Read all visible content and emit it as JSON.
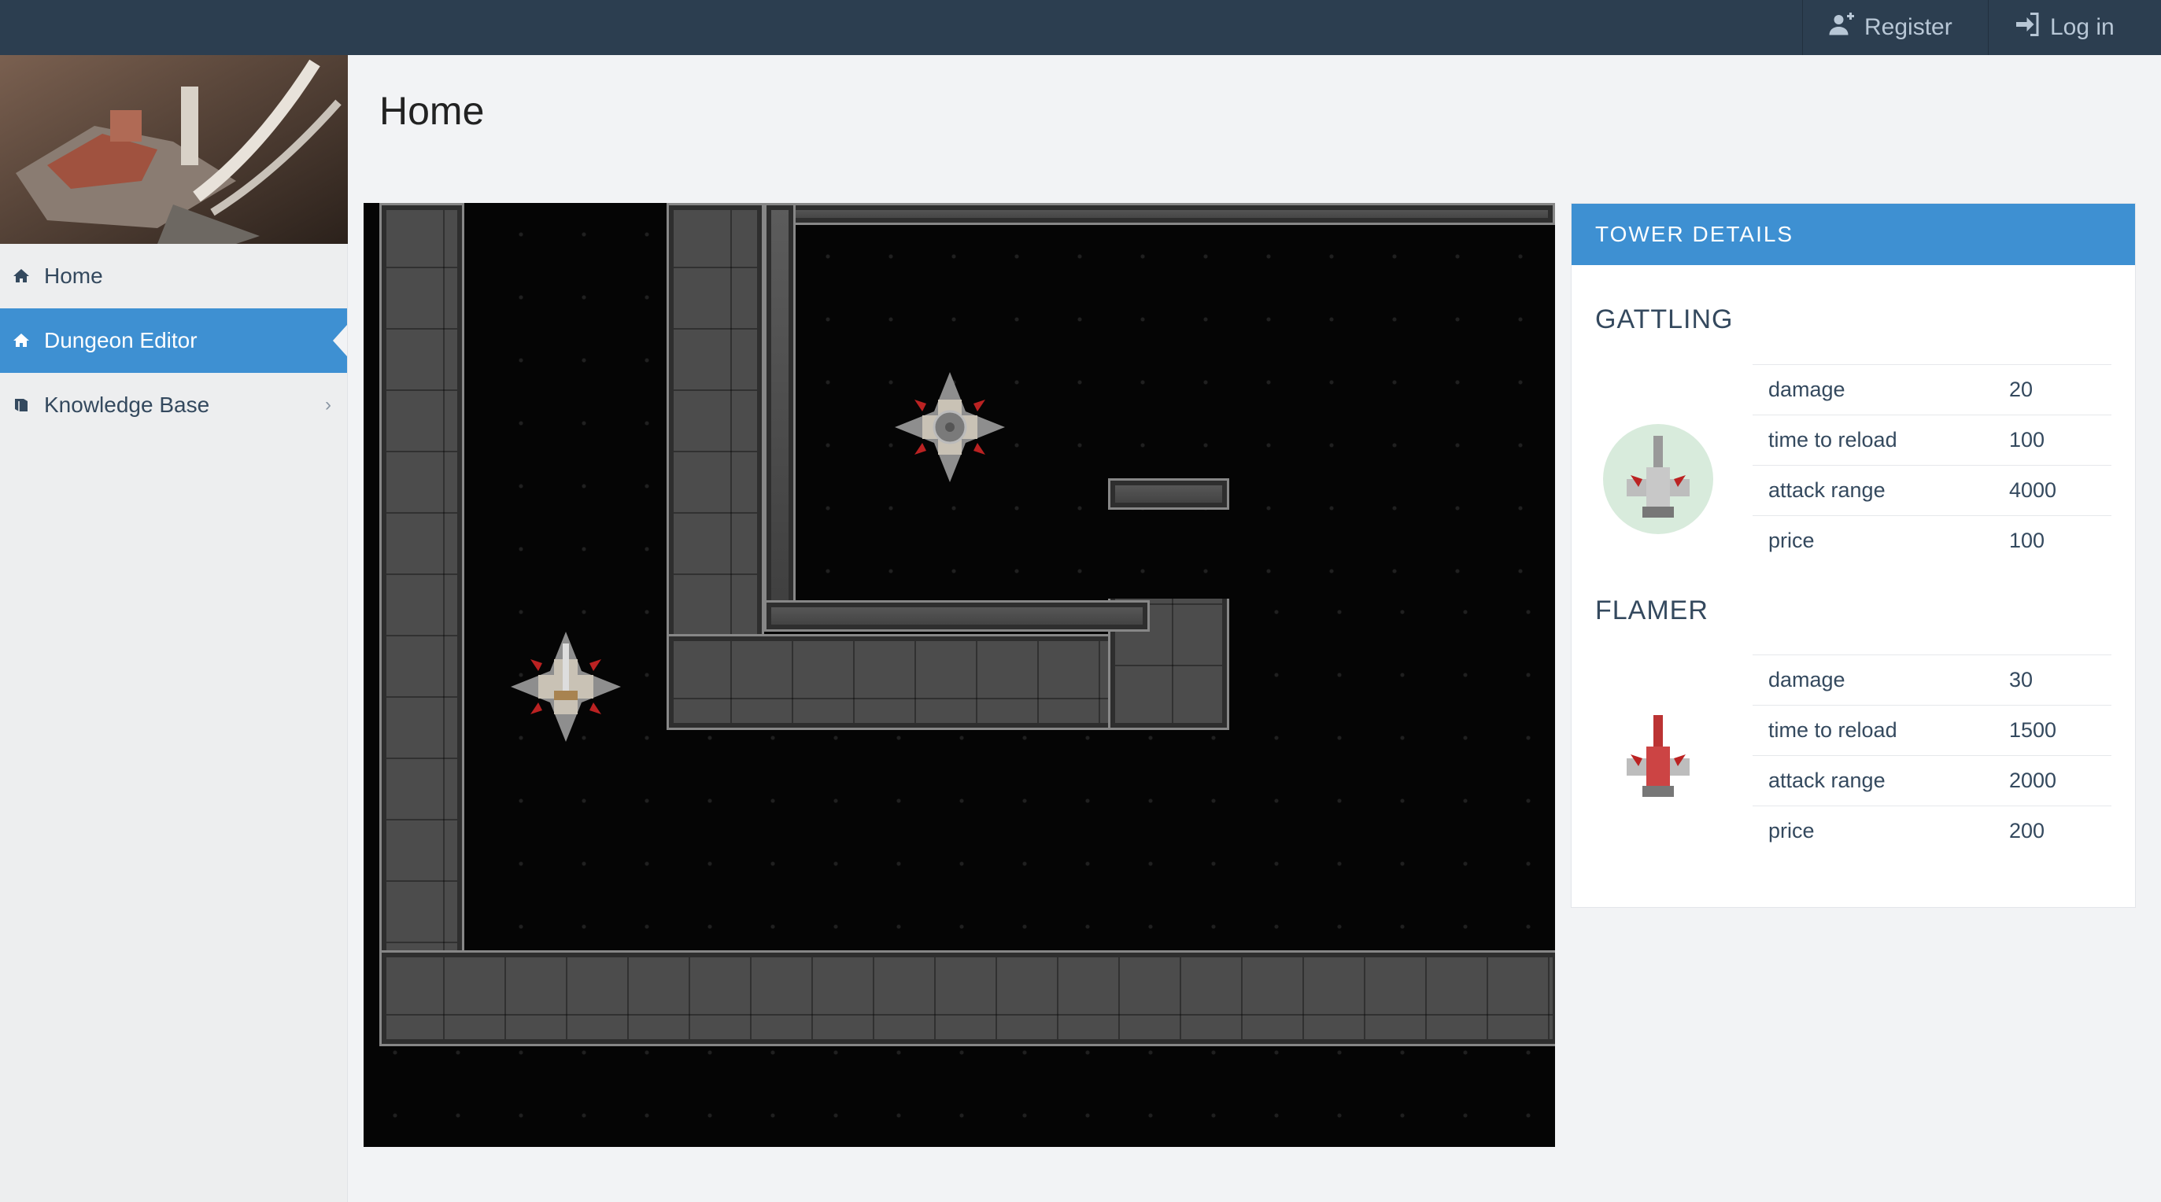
{
  "topbar": {
    "register_label": "Register",
    "login_label": "Log in"
  },
  "sidebar": {
    "items": [
      {
        "label": "Home",
        "icon": "home-icon",
        "active": false
      },
      {
        "label": "Dungeon Editor",
        "icon": "home-icon",
        "active": true
      },
      {
        "label": "Knowledge Base",
        "icon": "book-icon",
        "active": false
      }
    ]
  },
  "page": {
    "title": "Home"
  },
  "panel": {
    "title": "TOWER DETAILS",
    "towers": [
      {
        "name": "GATTLING",
        "stats": [
          {
            "label": "damage",
            "value": "20"
          },
          {
            "label": "time to reload",
            "value": "100"
          },
          {
            "label": "attack range",
            "value": "4000"
          },
          {
            "label": "price",
            "value": "100"
          }
        ]
      },
      {
        "name": "FLAMER",
        "stats": [
          {
            "label": "damage",
            "value": "30"
          },
          {
            "label": "time to reload",
            "value": "1500"
          },
          {
            "label": "attack range",
            "value": "2000"
          },
          {
            "label": "price",
            "value": "200"
          }
        ]
      }
    ]
  },
  "colors": {
    "topbar": "#2c3e50",
    "accent": "#3e90d2",
    "background": "#f2f3f5"
  }
}
